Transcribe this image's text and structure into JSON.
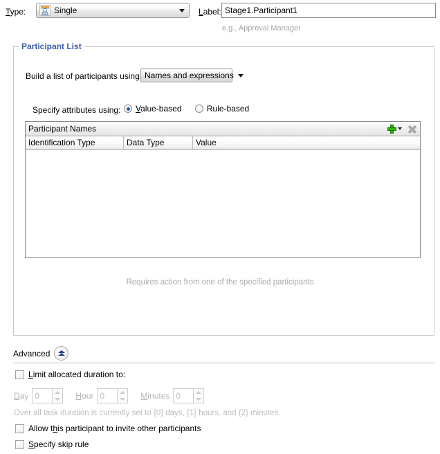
{
  "top": {
    "type_label": "Type:",
    "type_label_mnemonic": "T",
    "type_value": "Single",
    "type_icon": "single-participant-icon",
    "label_label": "Label:",
    "label_label_mnemonic": "L",
    "label_value": "Stage1.Participant1",
    "label_hint": "e.g., Approval Manager"
  },
  "participant_list": {
    "title": "Participant List",
    "title_color": "#3b5ca8",
    "build_label": "Build a list of participants using:",
    "build_value": "Names and expressions",
    "specify_label": "Specify attributes using:",
    "radios": [
      {
        "label": "Value-based",
        "mnemonic": "V",
        "checked": true
      },
      {
        "label": "Rule-based",
        "mnemonic": "R",
        "checked": false
      }
    ],
    "table": {
      "toolbar_title": "Participant Names",
      "add_icon": "add-plus-icon",
      "add_dropdown_icon": "chevron-down-icon",
      "delete_icon": "delete-x-icon",
      "columns": [
        "Identification Type",
        "Data Type",
        "Value"
      ],
      "rows": []
    },
    "note": "Requires action from one of the specified participants"
  },
  "advanced": {
    "label": "Advanced",
    "toggle_icon": "collapse-chevron-up-icon",
    "limit_duration": {
      "label": "Limit allocated duration to:",
      "mnemonic": "L",
      "checked": false
    },
    "duration_fields": [
      {
        "label": "Day",
        "mnemonic": "D",
        "value": "0"
      },
      {
        "label": "Hour",
        "mnemonic": "H",
        "value": "0"
      },
      {
        "label": "Minutes",
        "mnemonic": "M",
        "value": "0"
      }
    ],
    "duration_note": "Over all task duration is currently set to {0} days, {1} hours, and {2} minutes.",
    "allow_invite": {
      "label_pre": "Allow t",
      "label_mnemonic": "h",
      "label_post": "is participant to invite other participants",
      "checked": false
    },
    "skip_rule": {
      "label_pre": "",
      "label_mnemonic": "S",
      "label_post": "pecify skip rule",
      "checked": false
    }
  }
}
